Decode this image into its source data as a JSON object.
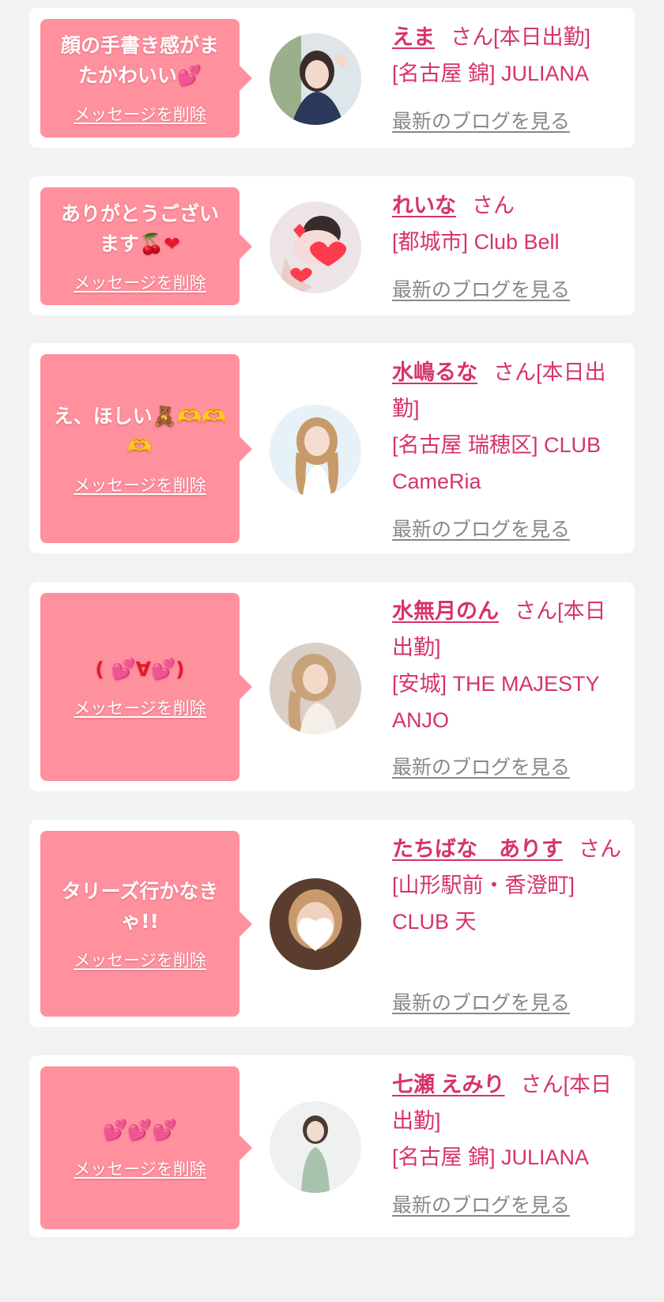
{
  "cards": [
    {
      "message": "顔の手書き感がまたかわいい",
      "message_emoji": "💕",
      "delete_label": "メッセージを削除",
      "name": "えま",
      "san": "さん[本日出勤]",
      "shop": "[名古屋 錦] JULIANA",
      "blog_label": "最新のブログを見る"
    },
    {
      "message": "ありがとうございます",
      "message_emoji": "🍒❤",
      "delete_label": "メッセージを削除",
      "name": "れいな",
      "san": "さん",
      "shop": "[都城市] Club Bell",
      "blog_label": "最新のブログを見る"
    },
    {
      "message": "え、ほしい",
      "message_emoji": "🧸🫶🫶🫶",
      "delete_label": "メッセージを削除",
      "name": "水嶋るな",
      "san": "さん[本日出勤]",
      "shop": "[名古屋 瑞穂区] CLUB CameRia",
      "blog_label": "最新のブログを見る"
    },
    {
      "message": "( 💕∀💕)",
      "message_emoji": "",
      "delete_label": "メッセージを削除",
      "name": "水無月のん",
      "san": "さん[本日出勤]",
      "shop": "[安城] THE MAJESTY ANJO",
      "blog_label": "最新のブログを見る"
    },
    {
      "message": "タリーズ行かなきゃ!!",
      "message_emoji": "",
      "delete_label": "メッセージを削除",
      "name": "たちばな　ありす",
      "san": "さん",
      "shop": "[山形駅前・香澄町] CLUB 天",
      "blog_label": "最新のブログを見る"
    },
    {
      "message": "💕💕💕",
      "message_emoji": "",
      "delete_label": "メッセージを削除",
      "name": "七瀬 えみり",
      "san": "さん[本日出勤]",
      "shop": "[名古屋 錦] JULIANA",
      "blog_label": "最新のブログを見る"
    }
  ],
  "colors": {
    "page_bg": "#f2f2f2",
    "card_bg": "#ffffff",
    "bubble": "#ff909e",
    "accent_pink": "#d6336c",
    "link_gray": "#888888"
  }
}
